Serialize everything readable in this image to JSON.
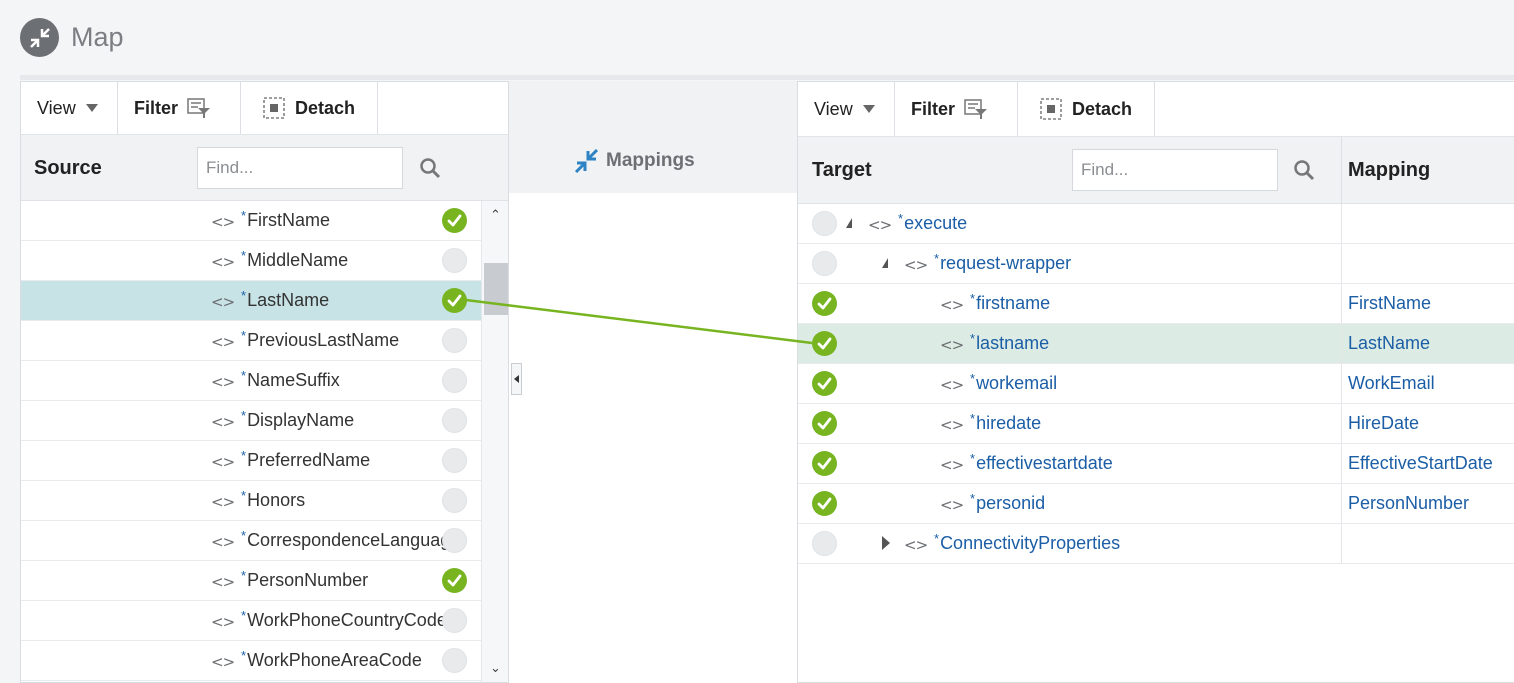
{
  "page": {
    "title": "Map"
  },
  "source_panel": {
    "toolbar": {
      "view": "View",
      "filter": "Filter",
      "detach": "Detach"
    },
    "column": "Source",
    "find_placeholder": "Find...",
    "rows": [
      {
        "name": "FirstName",
        "mapped": true,
        "selected": false
      },
      {
        "name": "MiddleName",
        "mapped": false,
        "selected": false
      },
      {
        "name": "LastName",
        "mapped": true,
        "selected": true
      },
      {
        "name": "PreviousLastName",
        "mapped": false,
        "selected": false
      },
      {
        "name": "NameSuffix",
        "mapped": false,
        "selected": false
      },
      {
        "name": "DisplayName",
        "mapped": false,
        "selected": false
      },
      {
        "name": "PreferredName",
        "mapped": false,
        "selected": false
      },
      {
        "name": "Honors",
        "mapped": false,
        "selected": false
      },
      {
        "name": "CorrespondenceLanguage",
        "mapped": false,
        "selected": false
      },
      {
        "name": "PersonNumber",
        "mapped": true,
        "selected": false
      },
      {
        "name": "WorkPhoneCountryCode",
        "mapped": false,
        "selected": false
      },
      {
        "name": "WorkPhoneAreaCode",
        "mapped": false,
        "selected": false
      }
    ]
  },
  "mappings": {
    "title": "Mappings"
  },
  "target_panel": {
    "toolbar": {
      "view": "View",
      "filter": "Filter",
      "detach": "Detach"
    },
    "column": "Target",
    "mapping_column": "Mapping",
    "find_placeholder": "Find...",
    "rows": [
      {
        "name": "execute",
        "mapped": false,
        "selected": false,
        "level": 0,
        "expander": "open",
        "mapping": ""
      },
      {
        "name": "request-wrapper",
        "mapped": false,
        "selected": false,
        "level": 1,
        "expander": "open",
        "mapping": ""
      },
      {
        "name": "firstname",
        "mapped": true,
        "selected": false,
        "level": 2,
        "expander": "none",
        "mapping": "FirstName"
      },
      {
        "name": "lastname",
        "mapped": true,
        "selected": true,
        "level": 2,
        "expander": "none",
        "mapping": "LastName"
      },
      {
        "name": "workemail",
        "mapped": true,
        "selected": false,
        "level": 2,
        "expander": "none",
        "mapping": "WorkEmail"
      },
      {
        "name": "hiredate",
        "mapped": true,
        "selected": false,
        "level": 2,
        "expander": "none",
        "mapping": "HireDate"
      },
      {
        "name": "effectivestartdate",
        "mapped": true,
        "selected": false,
        "level": 2,
        "expander": "none",
        "mapping": "EffectiveStartDate"
      },
      {
        "name": "personid",
        "mapped": true,
        "selected": false,
        "level": 2,
        "expander": "none",
        "mapping": "PersonNumber"
      },
      {
        "name": "ConnectivityProperties",
        "mapped": false,
        "selected": false,
        "level": 1,
        "expander": "closed",
        "mapping": ""
      }
    ]
  },
  "colors": {
    "accent_link": "#77b420",
    "node_blue": "#1b5ea6",
    "selected_source": "#c7e3e6",
    "selected_target": "#dcece4"
  }
}
